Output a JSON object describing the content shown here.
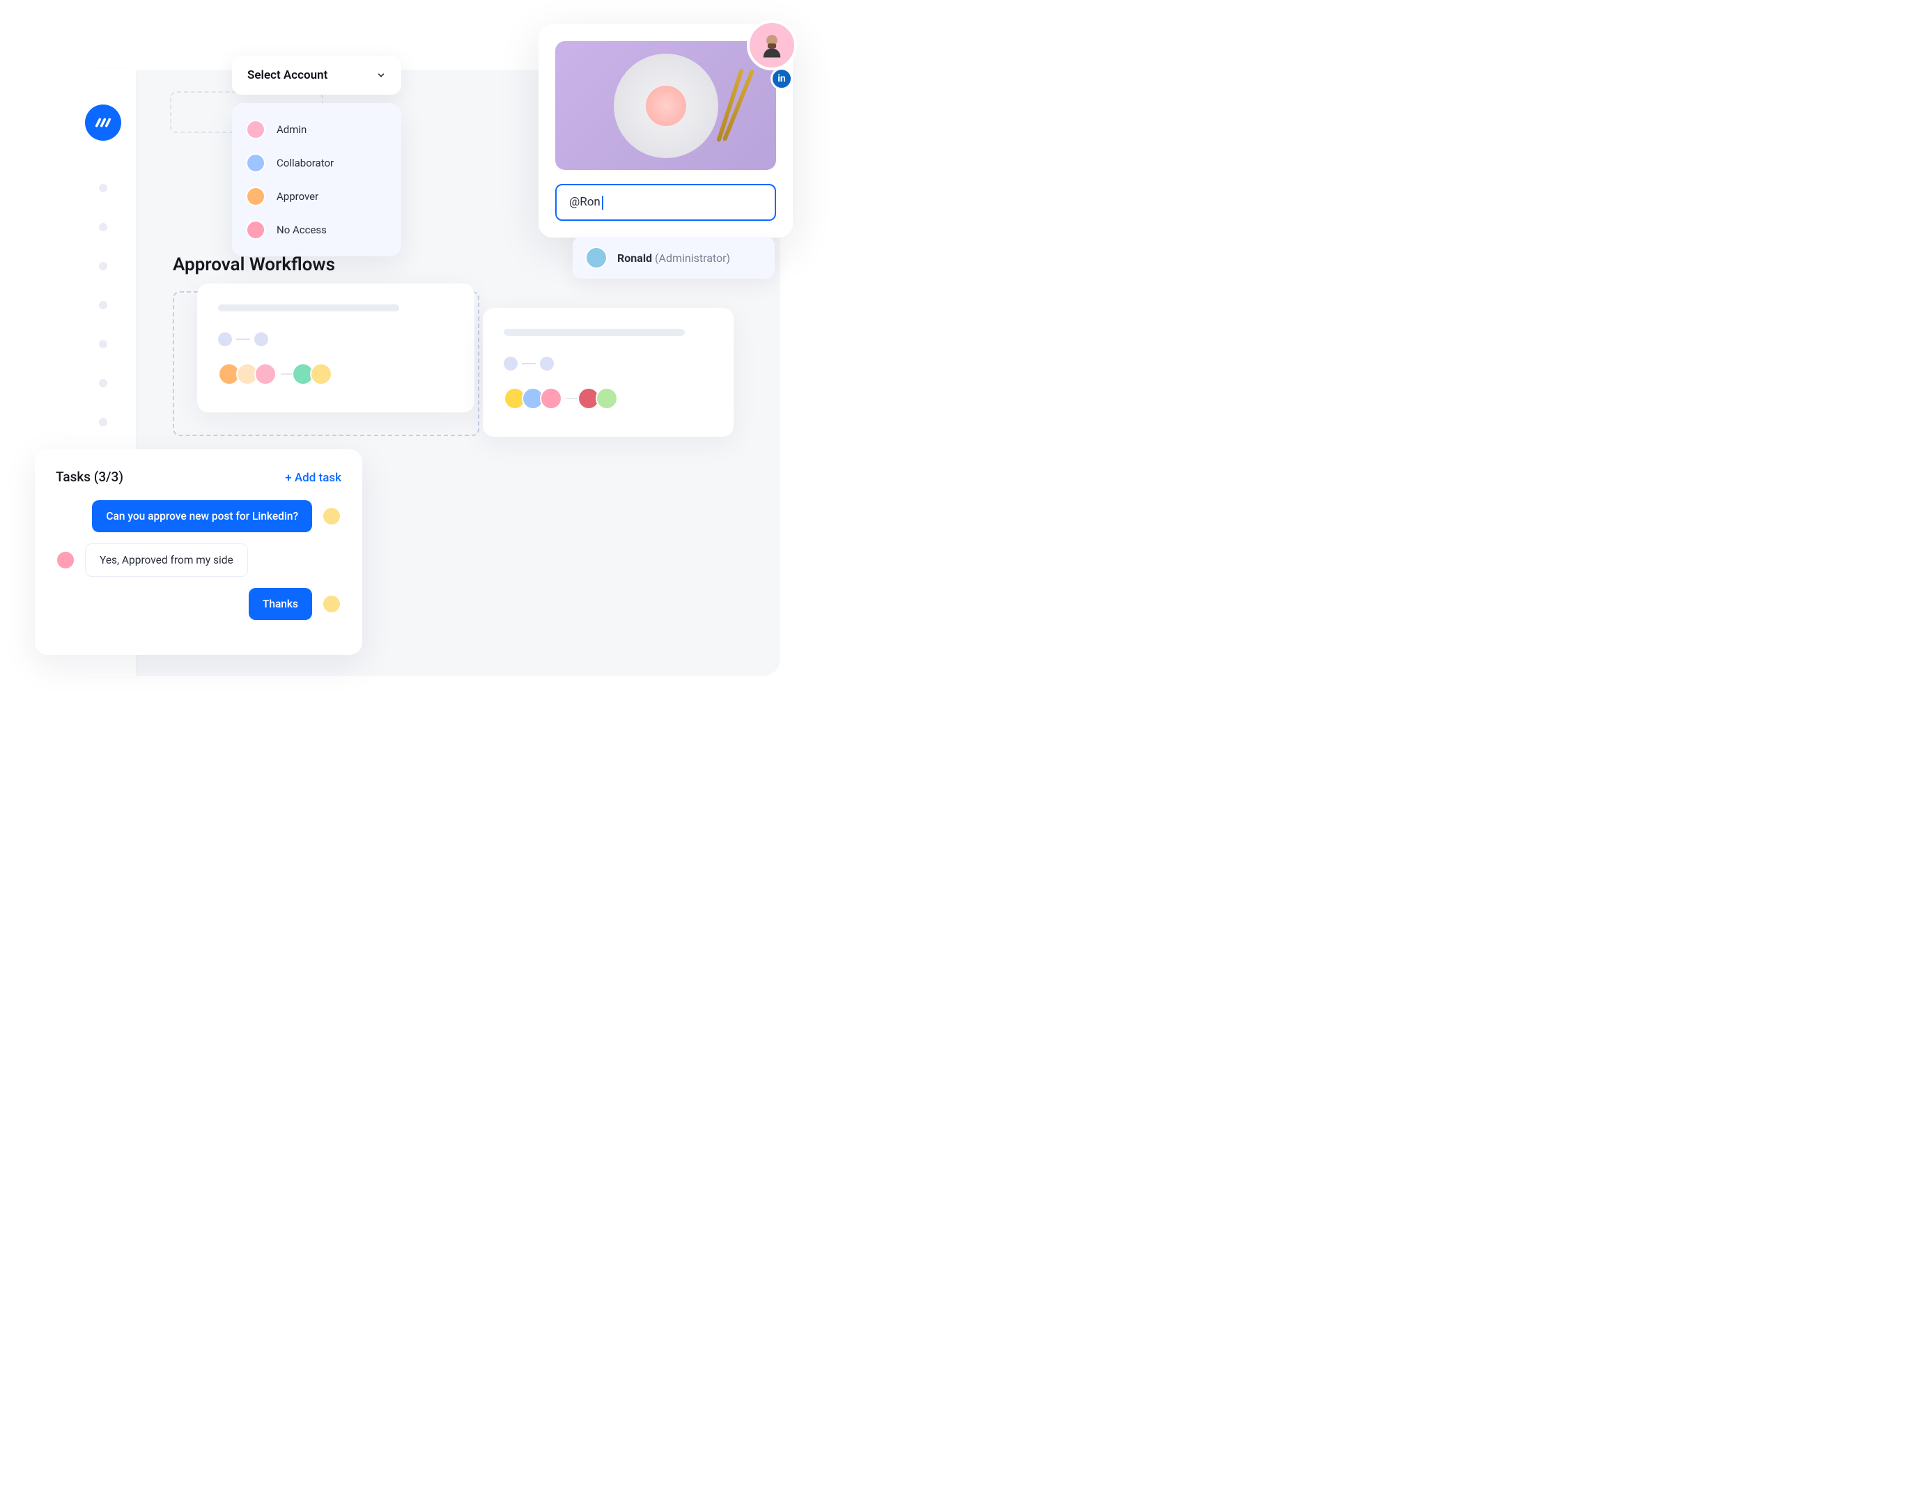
{
  "sidebar": {
    "logo_name": "app-logo"
  },
  "select_account": {
    "label": "Select Account",
    "options": [
      {
        "label": "Admin"
      },
      {
        "label": "Collaborator"
      },
      {
        "label": "Approver"
      },
      {
        "label": "No Access"
      }
    ]
  },
  "workflows": {
    "title": "Approval Workflows"
  },
  "tasks": {
    "title": "Tasks (3/3)",
    "add_label": "+ Add task",
    "messages": [
      {
        "text": "Can you approve new post for Linkedin?",
        "from": "me"
      },
      {
        "text": "Yes, Approved from my side",
        "from": "other"
      },
      {
        "text": "Thanks",
        "from": "me"
      }
    ]
  },
  "post": {
    "mention_value": "@Ron",
    "suggestion": {
      "name": "Ronald",
      "role": "(Administrator)"
    },
    "network": "in"
  }
}
